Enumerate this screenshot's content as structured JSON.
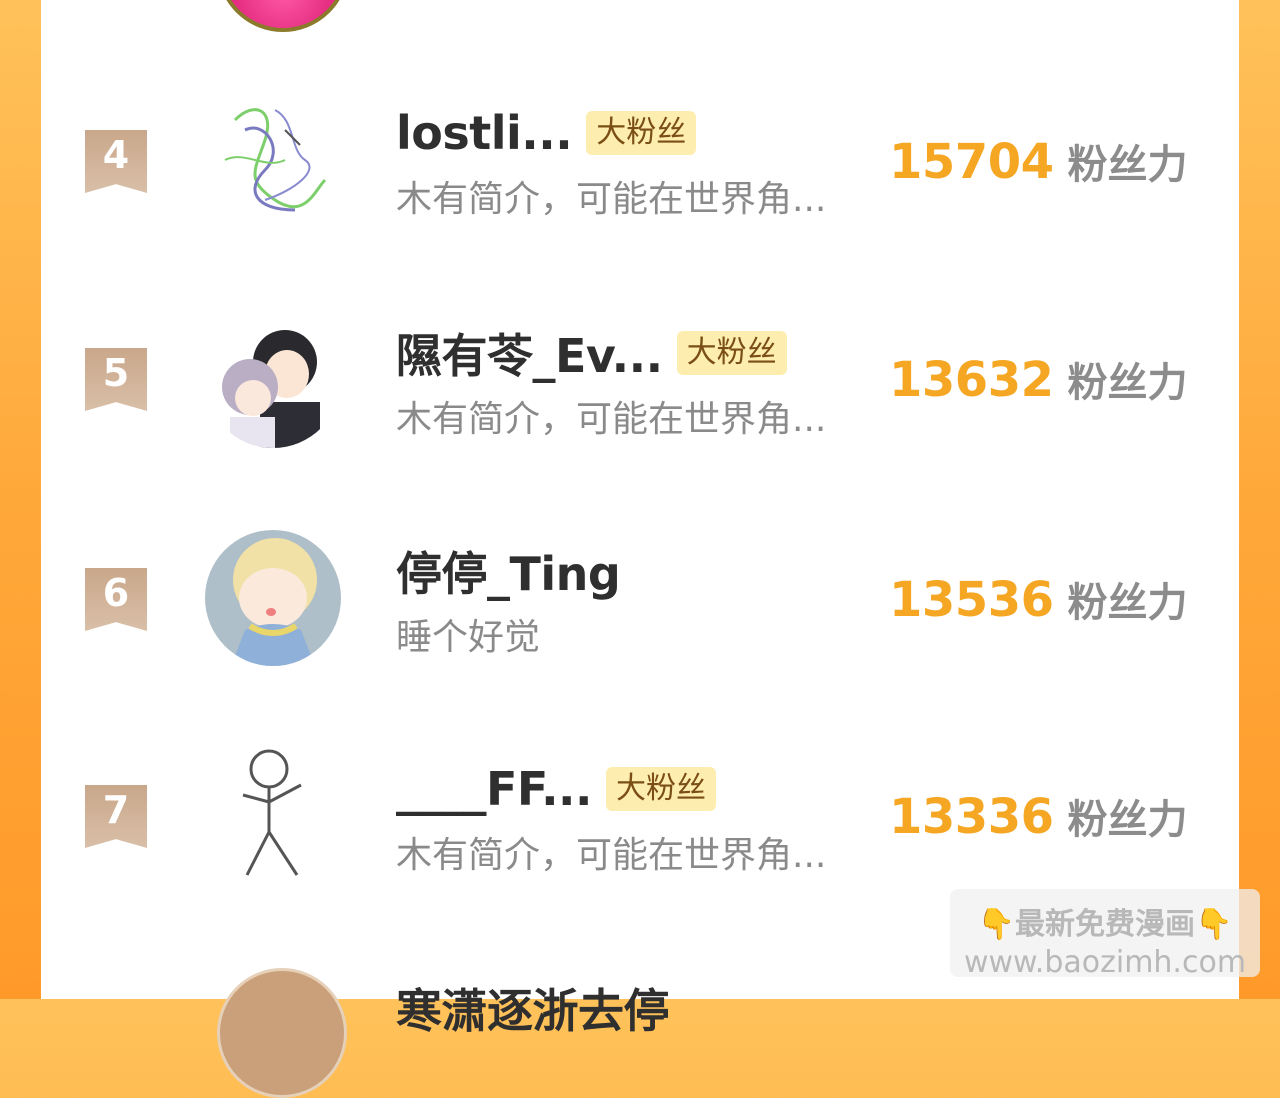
{
  "badge_label": "大粉丝",
  "score_label": "粉丝力",
  "rows": [
    {
      "rank": "4",
      "name": "lostli...",
      "has_badge": true,
      "bio": "木有简介，可能在世界角...",
      "score": "15704"
    },
    {
      "rank": "5",
      "name": "隰有苓_Ev...",
      "has_badge": true,
      "bio": "木有简介，可能在世界角...",
      "score": "13632"
    },
    {
      "rank": "6",
      "name": "停停_Ting",
      "has_badge": false,
      "bio": "睡个好觉",
      "score": "13536"
    },
    {
      "rank": "7",
      "name": "____FF...",
      "has_badge": true,
      "bio": "木有简介，可能在世界角...",
      "score": "13336"
    }
  ],
  "partial_next_name": "寒潇逐浙去停",
  "watermark": {
    "line1": "👇最新免费漫画👇",
    "line2": "www.baozimh.com"
  },
  "colors": {
    "accent": "#f5a623",
    "badge_bg": "#fdeeb0",
    "rank_badge": "#c9a78a"
  }
}
